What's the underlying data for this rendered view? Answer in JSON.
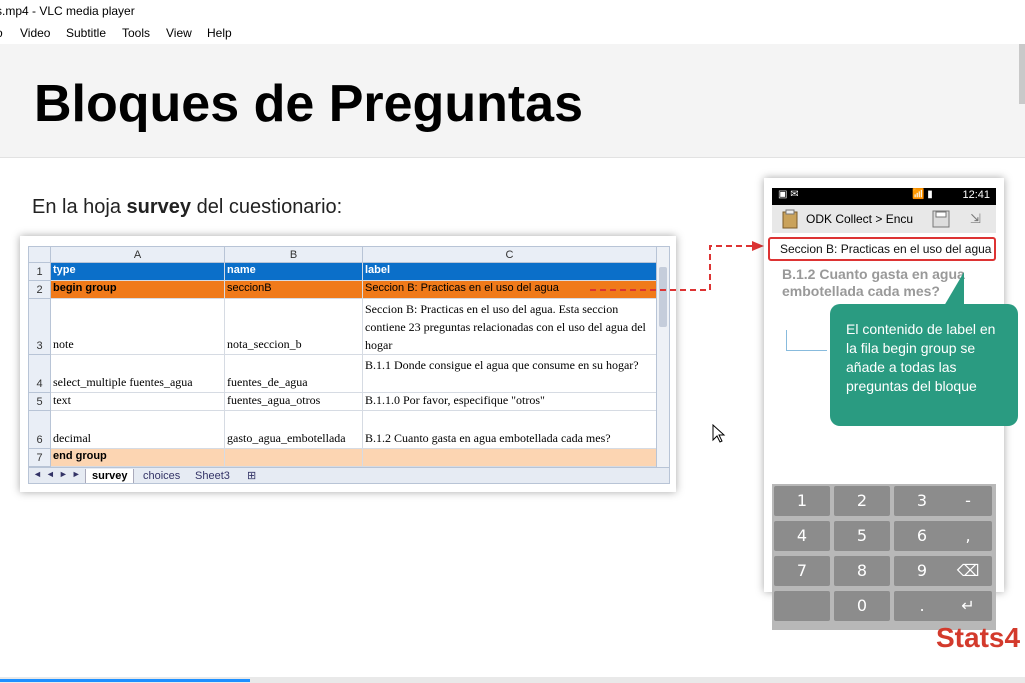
{
  "window": {
    "title": "s.mp4 - VLC media player"
  },
  "menu": [
    "o",
    "Video",
    "Subtitle",
    "Tools",
    "View",
    "Help"
  ],
  "slide": {
    "title": "Bloques de Preguntas",
    "subtitle_pre": "En la hoja ",
    "subtitle_bold": "survey",
    "subtitle_post": " del cuestionario:",
    "logo": "Stats4"
  },
  "sheet": {
    "columns": [
      "A",
      "B",
      "C"
    ],
    "rows": [
      {
        "num": "1",
        "a": "type",
        "b": "name",
        "c": "label"
      },
      {
        "num": "2",
        "a": "begin group",
        "b": "seccionB",
        "c": "Seccion B: Practicas en el uso del agua"
      },
      {
        "num": "3",
        "a": "note",
        "b": "nota_seccion_b",
        "c": "Seccion B: Practicas en el uso del agua. Esta seccion contiene 23 preguntas relacionadas con el uso del agua del hogar"
      },
      {
        "num": "4",
        "a": "select_multiple fuentes_agua",
        "b": "fuentes_de_agua",
        "c": "B.1.1 Donde consigue el agua que consume en su hogar?"
      },
      {
        "num": "5",
        "a": "text",
        "b": "fuentes_agua_otros",
        "c": "B.1.1.0 Por favor, especifique \"otros\""
      },
      {
        "num": "6",
        "a": "decimal",
        "b": "gasto_agua_embotellada",
        "c": "B.1.2 Cuanto gasta en agua embotellada cada mes?"
      },
      {
        "num": "7",
        "a": "end group",
        "b": "",
        "c": ""
      }
    ],
    "tabs": [
      "survey",
      "choices",
      "Sheet3"
    ]
  },
  "phone": {
    "time": "12:41",
    "app_title": "ODK Collect > Encu",
    "group_label": "Seccion B: Practicas en el uso del agua",
    "question": "B.1.2 Cuanto gasta en agua embotellada cada mes?",
    "keys": [
      "1",
      "2",
      "3",
      "-",
      "4",
      "5",
      "6",
      ",",
      "7",
      "8",
      "9",
      "⌫",
      "",
      "0",
      ".",
      "↵"
    ]
  },
  "callout": {
    "text": "El contenido de label en la fila begin group se añade a todas las preguntas del bloque"
  }
}
